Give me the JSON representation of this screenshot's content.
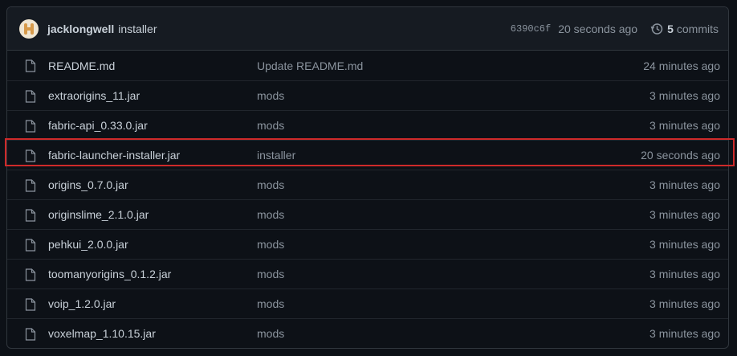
{
  "latest_commit": {
    "author": "jacklongwell",
    "message": "installer",
    "sha": "6390c6f",
    "time_ago": "20 seconds ago",
    "commit_count": "5",
    "commits_label": "commits"
  },
  "files": [
    {
      "name": "README.md",
      "message": "Update README.md",
      "age": "24 minutes ago"
    },
    {
      "name": "extraorigins_11.jar",
      "message": "mods",
      "age": "3 minutes ago"
    },
    {
      "name": "fabric-api_0.33.0.jar",
      "message": "mods",
      "age": "3 minutes ago"
    },
    {
      "name": "fabric-launcher-installer.jar",
      "message": "installer",
      "age": "20 seconds ago",
      "highlighted": true
    },
    {
      "name": "origins_0.7.0.jar",
      "message": "mods",
      "age": "3 minutes ago"
    },
    {
      "name": "originslime_2.1.0.jar",
      "message": "mods",
      "age": "3 minutes ago"
    },
    {
      "name": "pehkui_2.0.0.jar",
      "message": "mods",
      "age": "3 minutes ago"
    },
    {
      "name": "toomanyorigins_0.1.2.jar",
      "message": "mods",
      "age": "3 minutes ago"
    },
    {
      "name": "voip_1.2.0.jar",
      "message": "mods",
      "age": "3 minutes ago"
    },
    {
      "name": "voxelmap_1.10.15.jar",
      "message": "mods",
      "age": "3 minutes ago"
    }
  ],
  "icons": {
    "file": "file-icon",
    "history": "history-icon",
    "avatar": "avatar"
  },
  "colors": {
    "background": "#0d1117",
    "header": "#161b22",
    "border": "#30363d",
    "highlight": "#cf2a2a"
  }
}
